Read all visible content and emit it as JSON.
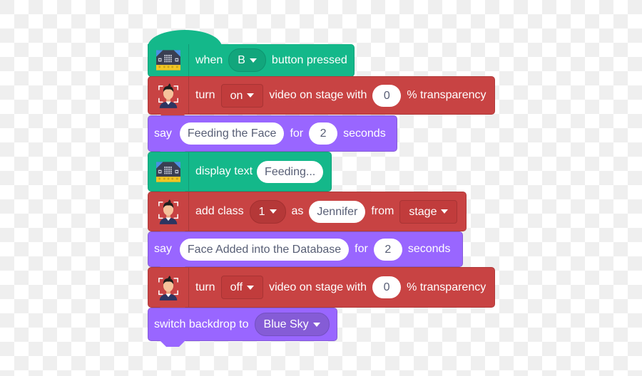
{
  "blocks": [
    {
      "type": "hat",
      "category": "microbit",
      "color": "#14b88a",
      "icon": "microbit-board-icon",
      "parts": {
        "t1": "when",
        "btn": "B",
        "t2": "button pressed"
      }
    },
    {
      "type": "command",
      "category": "face-detection",
      "color": "#c84343",
      "icon": "face-person-icon",
      "parts": {
        "t1": "turn",
        "state": "on",
        "t2": "video on stage with",
        "transparency": "0",
        "t3": "% transparency"
      }
    },
    {
      "type": "command",
      "category": "looks",
      "color": "#9966ff",
      "parts": {
        "t1": "say",
        "message": "Feeding the Face",
        "t2": "for",
        "secs": "2",
        "t3": "seconds"
      }
    },
    {
      "type": "command",
      "category": "microbit",
      "color": "#14b88a",
      "icon": "microbit-board-icon",
      "parts": {
        "t1": "display text",
        "text": "Feeding..."
      }
    },
    {
      "type": "command",
      "category": "face-detection",
      "color": "#c84343",
      "icon": "face-person-icon",
      "parts": {
        "t1": "add class",
        "cls": "1",
        "t2": "as",
        "name": "Jennifer",
        "t3": "from",
        "source": "stage"
      }
    },
    {
      "type": "command",
      "category": "looks",
      "color": "#9966ff",
      "parts": {
        "t1": "say",
        "message": "Face Added into the Database",
        "t2": "for",
        "secs": "2",
        "t3": "seconds"
      }
    },
    {
      "type": "command",
      "category": "face-detection",
      "color": "#c84343",
      "icon": "face-person-icon",
      "parts": {
        "t1": "turn",
        "state": "off",
        "t2": "video on stage with",
        "transparency": "0",
        "t3": "% transparency"
      }
    },
    {
      "type": "command",
      "category": "looks",
      "color": "#9966ff",
      "parts": {
        "t1": "switch backdrop to",
        "backdrop": "Blue Sky"
      }
    }
  ]
}
